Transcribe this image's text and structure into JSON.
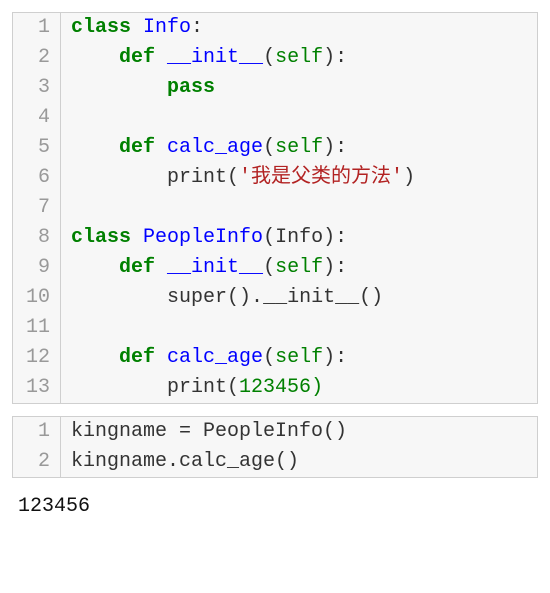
{
  "block1": {
    "lines": {
      "n1": "1",
      "n2": "2",
      "n3": "3",
      "n4": "4",
      "n5": "5",
      "n6": "6",
      "n7": "7",
      "n8": "8",
      "n9": "9",
      "n10": "10",
      "n11": "11",
      "n12": "12",
      "n13": "13"
    },
    "kw": {
      "class": "class",
      "def": "def",
      "pass": "pass"
    },
    "names": {
      "Info": "Info",
      "init": "__init__",
      "calc_age": "calc_age",
      "PeopleInfo": "PeopleInfo",
      "self": "self",
      "print": "print",
      "super": "super"
    },
    "str": {
      "parent_method": "'我是父类的方法'"
    },
    "num": {
      "v123456": "123456"
    },
    "punct": {
      "colon": ":",
      "open_paren": "(",
      "close_paren": ")",
      "close_paren_colon": "):",
      "dot": ".",
      "unit_call": "()",
      "space1": " ",
      "empty": ""
    },
    "indent": {
      "i0": "",
      "i1": "    ",
      "i2": "        "
    }
  },
  "block2": {
    "lines": {
      "n1": "1",
      "n2": "2"
    },
    "code": {
      "line1": "kingname = PeopleInfo()",
      "line2": "kingname.calc_age()"
    }
  },
  "output": {
    "text": "123456"
  },
  "chart_data": null
}
